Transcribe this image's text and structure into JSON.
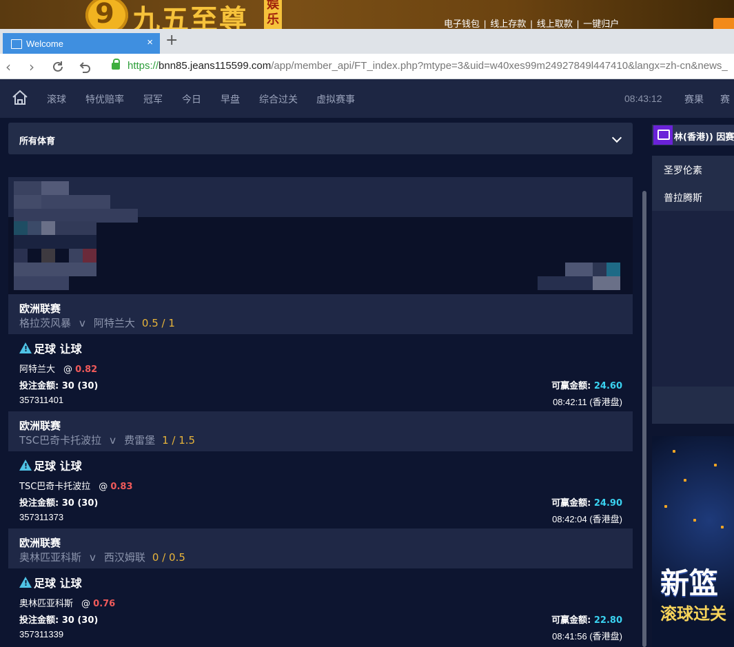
{
  "banner": {
    "logo_char": "9",
    "logo_text": "九五至尊",
    "logo_side": "娱乐",
    "links": [
      "电子钱包",
      "线上存款",
      "线上取款",
      "一键归户"
    ],
    "separator": "|"
  },
  "browser": {
    "tab_title": "Welcome",
    "tab_close": "×",
    "new_tab": "+",
    "url_scheme": "https://",
    "url_host": "bnn85.jeans115599.com",
    "url_path": "/app/member_api/FT_index.php?mtype=3&uid=w40xes99m24927849l447410&langx=zh-cn&news_"
  },
  "sitenav": {
    "items": [
      "滚球",
      "特优赔率",
      "冠军",
      "今日",
      "早盘",
      "综合过关",
      "虚拟赛事"
    ],
    "clock": "08:43:12",
    "right_items": [
      "赛果",
      "赛"
    ]
  },
  "filter": {
    "label": "所有体育"
  },
  "bets": [
    {
      "league": "欧洲联赛",
      "home": "格拉茨风暴",
      "vs": "v",
      "away": "阿特兰大",
      "handicap": "0.5 / 1",
      "type": "足球 让球",
      "pick": "阿特兰大",
      "at": "@",
      "odds": "0.82",
      "stake_label": "投注金额:",
      "stake": "30 (30)",
      "win_label": "可赢金额:",
      "win": "24.60",
      "ticket": "357311401",
      "time": "08:42:11 (香港盘)"
    },
    {
      "league": "欧洲联赛",
      "home": "TSC巴奇卡托波拉",
      "vs": "v",
      "away": "费雷堡",
      "handicap": "1 / 1.5",
      "type": "足球 让球",
      "pick": "TSC巴奇卡托波拉",
      "at": "@",
      "odds": "0.83",
      "stake_label": "投注金额:",
      "stake": "30 (30)",
      "win_label": "可赢金额:",
      "win": "24.90",
      "ticket": "357311373",
      "time": "08:42:04 (香港盘)"
    },
    {
      "league": "欧洲联赛",
      "home": "奥林匹亚科斯",
      "vs": "v",
      "away": "西汉姆联",
      "handicap": "0 / 0.5",
      "type": "足球 让球",
      "pick": "奥林匹亚科斯",
      "at": "@",
      "odds": "0.76",
      "stake_label": "投注金额:",
      "stake": "30 (30)",
      "win_label": "可赢金额:",
      "win": "22.80",
      "ticket": "357311339",
      "time": "08:41:56 (香港盘)"
    }
  ],
  "right_panel": {
    "news": "林(香港)) 因赛事",
    "list": [
      "圣罗伦素",
      "普拉腾斯"
    ],
    "promo_line1": "新篮",
    "promo_line2": "滚球过关"
  },
  "colors": {
    "background": "#0d1530",
    "panel": "#1f2846",
    "odds": "#f05a5a",
    "win_amount": "#3ad2f0",
    "handicap": "#e7b43a"
  }
}
